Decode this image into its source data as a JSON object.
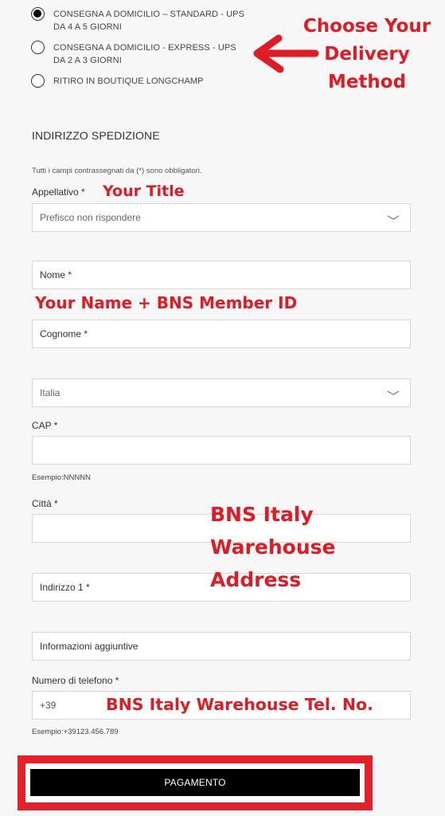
{
  "delivery": {
    "options": [
      {
        "line1": "CONSEGNA A DOMICILIO – STANDARD - UPS",
        "line2": "DA 4 A 5 GIORNI",
        "selected": true
      },
      {
        "line1": "CONSEGNA A DOMICILIO - EXPRESS - UPS",
        "line2": "DA 2 A 3 GIORNI",
        "selected": false
      },
      {
        "line1": "RITIRO IN BOUTIQUE LONGCHAMP",
        "line2": "",
        "selected": false
      }
    ]
  },
  "shipping": {
    "title": "INDIRIZZO SPEDIZIONE",
    "required_note": "Tutti i campi contrassegnati da (*) sono obbligatori.",
    "title_field": {
      "label": "Appellativo *",
      "value": "Prefisco non rispondere"
    },
    "first_name": {
      "placeholder": "Nome *"
    },
    "last_name": {
      "placeholder": "Cognome *"
    },
    "country": {
      "value": "Italia"
    },
    "postcode": {
      "label": "CAP *",
      "value": "",
      "hint": "Esempio:NNNNN"
    },
    "city": {
      "label": "Città *",
      "value": ""
    },
    "address1": {
      "placeholder": "Indirizzo 1 *"
    },
    "address2": {
      "placeholder": "Informazioni aggiuntive"
    },
    "phone": {
      "label": "Numero di telefono *",
      "prefix": "+39",
      "hint": "Esempio:+39123.456.789"
    },
    "submit_label": "PAGAMENTO"
  },
  "annotations": {
    "delivery_line1": "Choose Your",
    "delivery_line2": "Delivery",
    "delivery_line3": "Method",
    "title": "Your Title",
    "name": "Your Name + BNS Member ID",
    "address_line1": "BNS Italy",
    "address_line2": "Warehouse",
    "address_line3": "Address",
    "phone": "BNS Italy Warehouse Tel. No.",
    "color": "#e01b24"
  }
}
